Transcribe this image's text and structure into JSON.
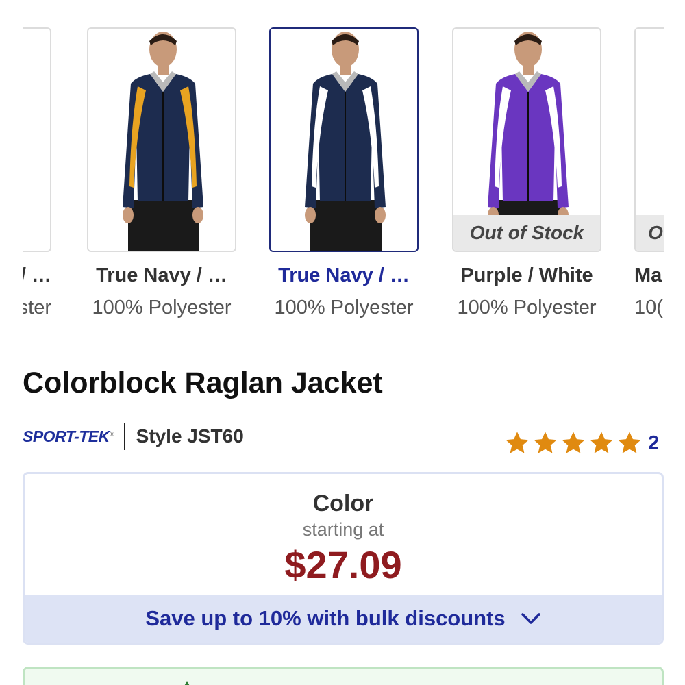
{
  "swatches": [
    {
      "name": "/ …",
      "material": "ster",
      "colors": {
        "body": "#2146b8",
        "accent": "#2146b8"
      },
      "out_of_stock": false
    },
    {
      "name": "True Navy / …",
      "material": "100% Polyester",
      "colors": {
        "body": "#1d2c4f",
        "accent": "#e8a321"
      },
      "out_of_stock": false
    },
    {
      "name": "True Navy / …",
      "material": "100% Polyester",
      "colors": {
        "body": "#1d2c4f",
        "accent": "#ffffff"
      },
      "out_of_stock": false,
      "selected": true
    },
    {
      "name": "Purple / White",
      "material": "100% Polyester",
      "colors": {
        "body": "#6a36c0",
        "accent": "#ffffff"
      },
      "out_of_stock": true,
      "oos_label": "Out of Stock"
    },
    {
      "name": "Ma",
      "material": "10(",
      "colors": {
        "body": "#5a1a24",
        "accent": "#5a1a24"
      },
      "out_of_stock": true,
      "oos_label": "O"
    }
  ],
  "product": {
    "title": "Colorblock Raglan Jacket",
    "brand": "SPORT-TEK",
    "style": "Style JST60",
    "rating_stars": 5,
    "review_count": "2"
  },
  "price_box": {
    "label": "Color",
    "sub": "starting at",
    "price": "$27.09",
    "bulk": "Save up to 10% with bulk discounts"
  },
  "colors": {
    "brand": "#1f2a9a",
    "price": "#8f1b1f",
    "star": "#e08a10"
  }
}
